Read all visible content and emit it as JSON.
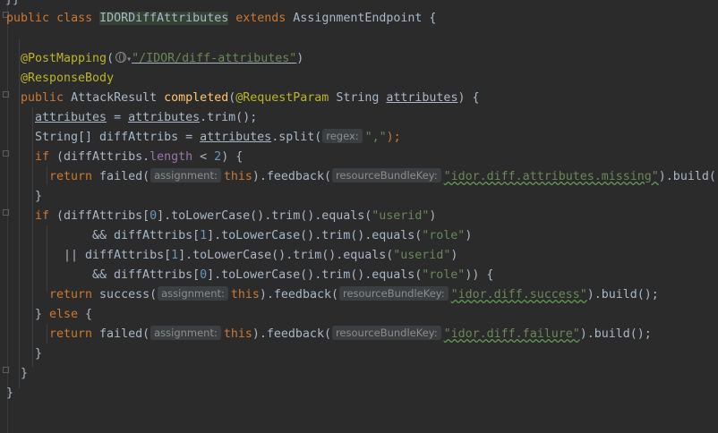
{
  "code": {
    "l_top_fragment": "}}",
    "l1_public": "public",
    "l1_class": "class",
    "l1_name": "IDORDiffAttributes",
    "l1_extends": "extends",
    "l1_parent": "AssignmentEndpoint {",
    "l3_annotation": "@PostMapping",
    "l3_path": "\"/IDOR/diff-attributes\"",
    "l4_annotation": "@ResponseBody",
    "l5_public": "public",
    "l5_type": "AttackResult",
    "l5_method": "completed",
    "l5_param_ann": "@RequestParam",
    "l5_param_type": "String",
    "l5_param_name": "attributes",
    "l5_rest": ") {",
    "l6_var": "attributes",
    "l6_eq": " = ",
    "l6_var2": "attributes",
    "l6_call": ".trim();",
    "l7_decl": "String[] diffAttribs = ",
    "l7_var": "attributes",
    "l7_call": ".split(",
    "l7_hint": "regex:",
    "l7_str": "\",\"",
    "l7_end": ");",
    "l8_if": "if",
    "l8_a": " (diffAttribs.",
    "l8_field": "length",
    "l8_b": " < ",
    "l8_num": "2",
    "l8_c": ") {",
    "l9_return": "return",
    "l9_a": " failed(",
    "l9_hint1": "assignment:",
    "l9_this": "this",
    "l9_b": ").feedback(",
    "l9_hint2": "resourceBundleKey:",
    "l9_str": "\"idor.diff.attributes.missing\"",
    "l9_c": ").build(",
    "l10_close": "}",
    "l11_if": "if",
    "l11_a": " (diffAttribs[",
    "l11_num": "0",
    "l11_b": "].toLowerCase().trim().equals(",
    "l11_str": "\"userid\"",
    "l11_c": ")",
    "l12_a": "&& diffAttribs[",
    "l12_num": "1",
    "l12_b": "].toLowerCase().trim().equals(",
    "l12_str": "\"role\"",
    "l12_c": ")",
    "l13_a": "|| diffAttribs[",
    "l13_num": "1",
    "l13_b": "].toLowerCase().trim().equals(",
    "l13_str": "\"userid\"",
    "l13_c": ")",
    "l14_a": "&& diffAttribs[",
    "l14_num": "0",
    "l14_b": "].toLowerCase().trim().equals(",
    "l14_str": "\"role\"",
    "l14_c": ")) {",
    "l15_return": "return",
    "l15_a": " success(",
    "l15_hint1": "assignment:",
    "l15_this": "this",
    "l15_b": ").feedback(",
    "l15_hint2": "resourceBundleKey:",
    "l15_str": "\"idor.diff.success\"",
    "l15_c": ").build();",
    "l16_a": "} ",
    "l16_else": "else",
    "l16_b": " {",
    "l17_return": "return",
    "l17_a": " failed(",
    "l17_hint1": "assignment:",
    "l17_this": "this",
    "l17_b": ").feedback(",
    "l17_hint2": "resourceBundleKey:",
    "l17_str": "\"idor.diff.failure\"",
    "l17_c": ").build();",
    "l18_close": "}",
    "l19_close": "}",
    "l20_close": "}"
  },
  "colors": {
    "background": "#2b2b2b",
    "keyword": "#cc7832",
    "annotation": "#bbb529",
    "string": "#6a8759",
    "number": "#6897bb",
    "field": "#9876aa",
    "method_declaration": "#ffc66d",
    "default_text": "#a9b7c6",
    "inlay_hint": "#8c8c8c"
  },
  "icons": {
    "url_mapping": "globe-icon",
    "url_mapping_dropdown": "chevron-down-icon"
  }
}
